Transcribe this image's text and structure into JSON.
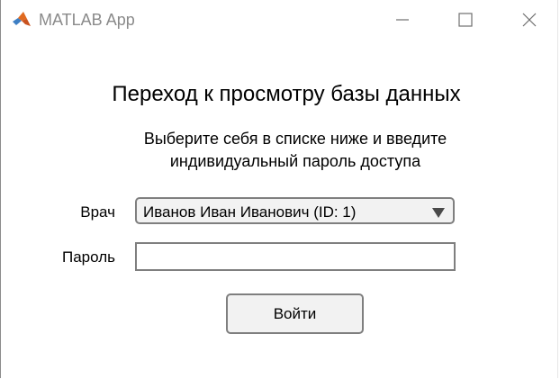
{
  "window": {
    "title": "MATLAB App",
    "icon": "matlab-logo-icon",
    "controls": {
      "minimize": "minimize-icon",
      "maximize": "maximize-icon",
      "close": "close-icon"
    }
  },
  "main": {
    "heading": "Переход к просмотру базы данных",
    "instruction_line1": "Выберите себя в списке ниже и введите",
    "instruction_line2": "индивидуальный пароль доступа"
  },
  "form": {
    "doctor_label": "Врач",
    "doctor_selected": "Иванов Иван Иванович (ID: 1)",
    "password_label": "Пароль",
    "password_value": "",
    "password_placeholder": "",
    "login_label": "Войти"
  },
  "colors": {
    "control_border": "#7f7f7f",
    "control_background": "#f2f2f2",
    "title_text": "#8a8a8a"
  }
}
